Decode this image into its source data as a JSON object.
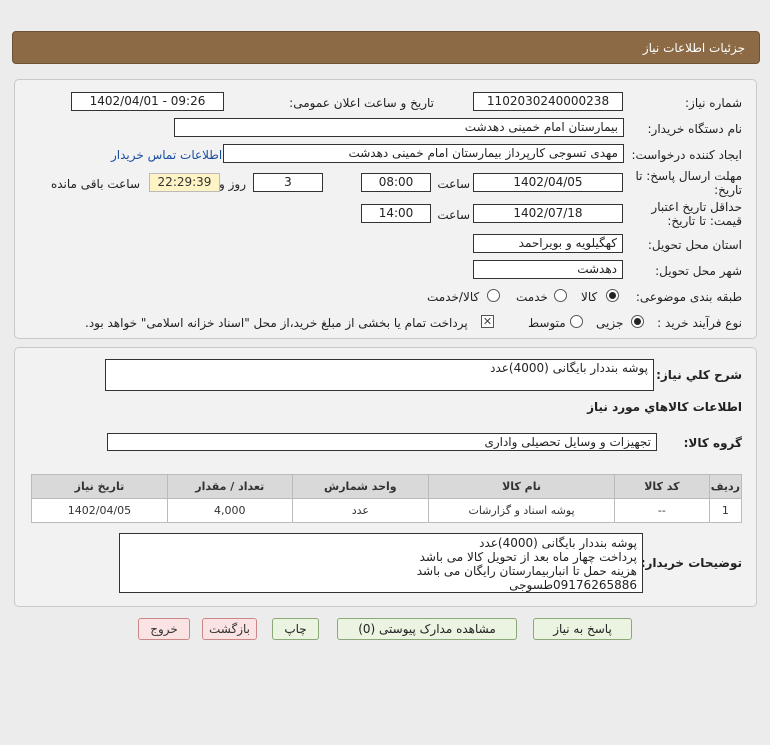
{
  "header": {
    "title": "جزئیات اطلاعات نیاز"
  },
  "info": {
    "need_number_label": "شماره نیاز:",
    "need_number": "1102030240000238",
    "announce_label": "تاریخ و ساعت اعلان عمومی:",
    "announce_value": "1402/04/01 - 09:26",
    "buyer_org_label": "نام دستگاه خریدار:",
    "buyer_org": "بیمارستان امام خمینی دهدشت",
    "requester_label": "ایجاد کننده درخواست:",
    "requester": "مهدی تسوجی کارپرداز بیمارستان امام خمینی دهدشت",
    "contact_link": "اطلاعات تماس خریدار",
    "send_deadline_label_1": "مهلت ارسال پاسخ: تا",
    "send_deadline_label_2": "تاریخ:",
    "send_date": "1402/04/05",
    "time_label": "ساعت",
    "send_time": "08:00",
    "days_value": "3",
    "days_label": "روز و",
    "remaining_time": "22:29:39",
    "remaining_label": "ساعت باقی مانده",
    "validity_label_1": "حداقل تاریخ اعتبار",
    "validity_label_2": "قیمت: تا تاریخ:",
    "validity_date": "1402/07/18",
    "validity_time": "14:00",
    "province_label": "استان محل تحویل:",
    "province": "کهگیلویه و بویراحمد",
    "city_label": "شهر محل تحویل:",
    "city": "دهدشت",
    "category_label": "طبقه بندی موضوعی:",
    "category_options": [
      "کالا",
      "خدمت",
      "کالا/خدمت"
    ],
    "process_label": "نوع فرآیند خرید :",
    "process_options": [
      "جزیی",
      "متوسط"
    ],
    "payment_note": "پرداخت تمام یا بخشی از مبلغ خرید،از محل \"اسناد خزانه اسلامی\" خواهد بود."
  },
  "details": {
    "summary_label": "شرح کلي نياز:",
    "summary": "پوشه بنددار بایگانی (4000)عدد",
    "goods_info_title": "اطلاعات کالاهاي مورد نياز",
    "goods_group_label": "گروه کالا:",
    "goods_group": "تجهیزات و وسایل تحصیلی واداری",
    "table": {
      "headers": [
        "ردیف",
        "کد کالا",
        "نام کالا",
        "واحد شمارش",
        "تعداد / مقدار",
        "تاریخ نیاز"
      ],
      "rows": [
        [
          "1",
          "--",
          "پوشه اسناد و گزارشات",
          "عدد",
          "4,000",
          "1402/04/05"
        ]
      ]
    },
    "buyer_notes_label": "توضیحات خریدار:",
    "buyer_notes": [
      "پوشه بنددار بایگانی (4000)عدد",
      "پرداخت چهار ماه بعد از تحویل کالا می باشد",
      "هزینه حمل تا انباربیمارستان رایگان می باشد",
      "09176265886طسوجی"
    ]
  },
  "buttons": {
    "reply": "پاسخ به نیاز",
    "attachments": "مشاهده مدارک پیوستی (0)",
    "print": "چاپ",
    "back": "بازگشت",
    "exit": "خروج"
  }
}
